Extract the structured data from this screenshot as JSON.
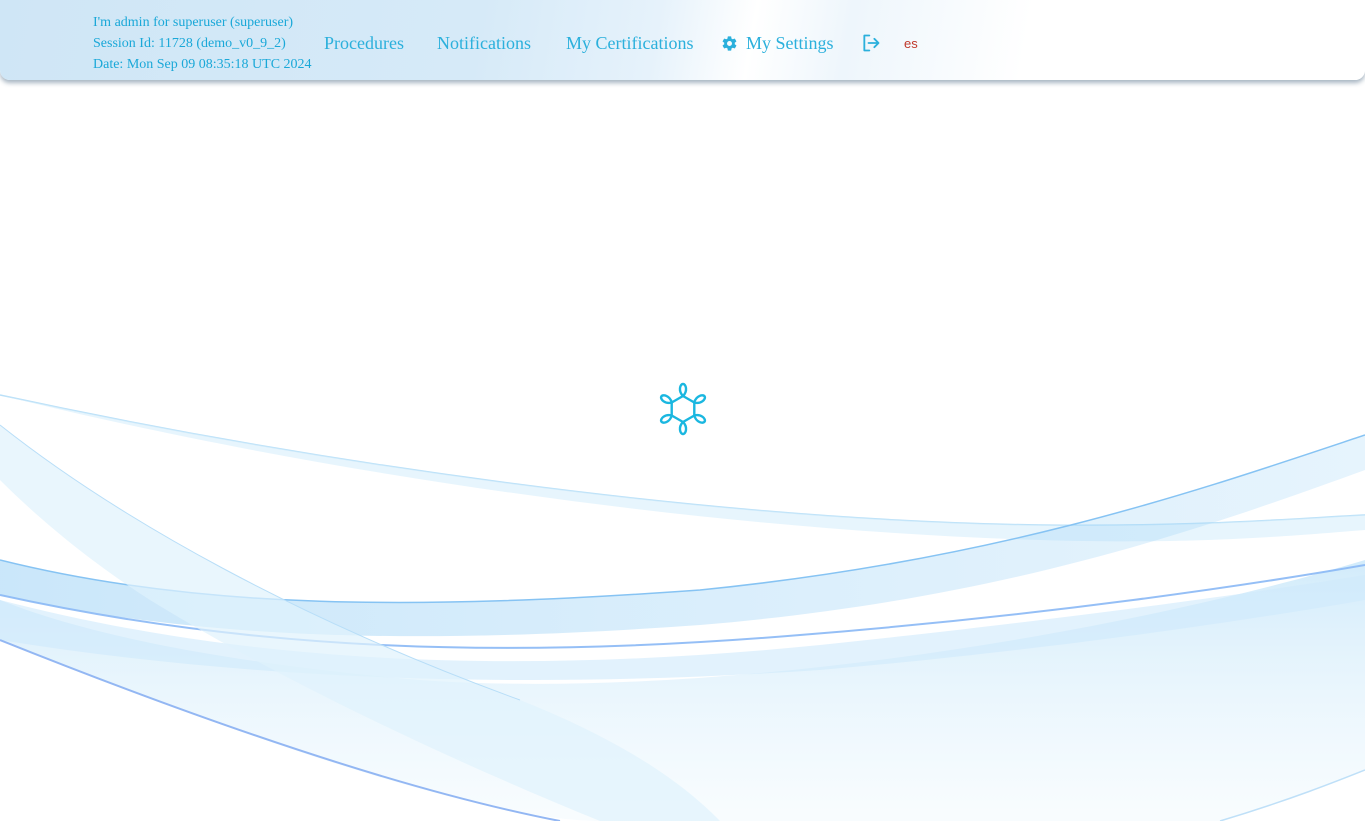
{
  "session": {
    "user_line": "I'm admin for superuser (superuser)",
    "session_line": "Session Id: 11728 (demo_v0_9_2)",
    "date_line": "Date: Mon Sep 09 08:35:18 UTC 2024"
  },
  "nav": {
    "procedures": "Procedures",
    "notifications": "Notifications",
    "certifications": "My Certifications",
    "settings": "My Settings"
  },
  "language": "es",
  "icons": {
    "settings": "gear-icon",
    "logout": "logout-icon",
    "loading": "loading-spinner-icon"
  },
  "colors": {
    "accent": "#2bb0dc",
    "language": "#c0392b",
    "wave": "#8ec9f5"
  }
}
